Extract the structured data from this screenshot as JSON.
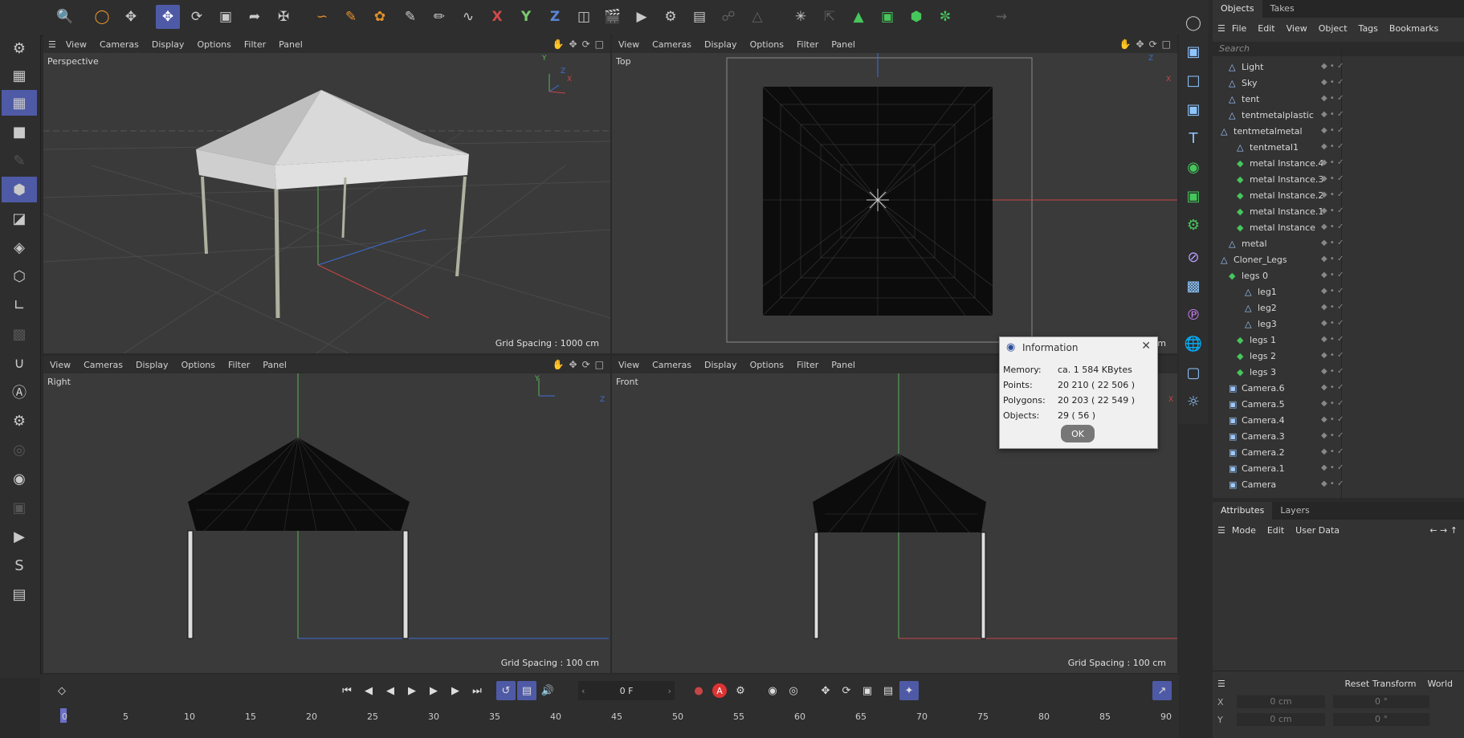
{
  "top_toolbar": {
    "icons": [
      "search-icon",
      "live-select-icon",
      "move-select-icon",
      "move-tool-icon",
      "rotate-tool-icon",
      "scale-tool-icon",
      "transform-icon",
      "pivot-icon",
      "spline-pen-icon",
      "brush-icon",
      "paint-icon",
      "knife-icon",
      "brush-tool-icon",
      "sketch-icon",
      "lasso-icon"
    ],
    "axis_x": "X",
    "axis_y": "Y",
    "axis_z": "Z"
  },
  "viewport_menu": [
    "View",
    "Cameras",
    "Display",
    "Options",
    "Filter",
    "Panel"
  ],
  "viewports": {
    "perspective": {
      "name": "Perspective",
      "grid": "Grid Spacing : 1000 cm"
    },
    "top": {
      "name": "Top",
      "grid_tail": "cm"
    },
    "right": {
      "name": "Right",
      "grid": "Grid Spacing : 100 cm"
    },
    "front": {
      "name": "Front",
      "grid": "Grid Spacing : 100 cm"
    }
  },
  "axis_labels": {
    "x": "X",
    "y": "Y",
    "z": "Z"
  },
  "info_dialog": {
    "title": "Information",
    "rows": [
      {
        "label": "Memory:",
        "value": "ca. 1 584 KBytes"
      },
      {
        "label": "Points:",
        "value": "20 210 ( 22 506 )"
      },
      {
        "label": "Polygons:",
        "value": "20 203 ( 22 549 )"
      },
      {
        "label": "Objects:",
        "value": "29 ( 56 )"
      }
    ],
    "ok": "OK"
  },
  "object_manager": {
    "tabs": [
      "Objects",
      "Takes"
    ],
    "menu": [
      "File",
      "Edit",
      "View",
      "Object",
      "Tags",
      "Bookmarks"
    ],
    "search_placeholder": "Search",
    "objects": [
      {
        "name": "Light",
        "indent": 1
      },
      {
        "name": "Sky",
        "indent": 1
      },
      {
        "name": "tent",
        "indent": 1
      },
      {
        "name": "tentmetalplastic",
        "indent": 1
      },
      {
        "name": "tentmetalmetal",
        "indent": 0
      },
      {
        "name": "tentmetal1",
        "indent": 2
      },
      {
        "name": "metal Instance.4",
        "indent": 2
      },
      {
        "name": "metal Instance.3",
        "indent": 2
      },
      {
        "name": "metal Instance.2",
        "indent": 2
      },
      {
        "name": "metal Instance.1",
        "indent": 2
      },
      {
        "name": "metal Instance",
        "indent": 2
      },
      {
        "name": "metal",
        "indent": 1
      },
      {
        "name": "Cloner_Legs",
        "indent": 0
      },
      {
        "name": "legs 0",
        "indent": 1
      },
      {
        "name": "leg1",
        "indent": 3
      },
      {
        "name": "leg2",
        "indent": 3
      },
      {
        "name": "leg3",
        "indent": 3
      },
      {
        "name": "legs 1",
        "indent": 2
      },
      {
        "name": "legs 2",
        "indent": 2
      },
      {
        "name": "legs 3",
        "indent": 2
      },
      {
        "name": "Camera.6",
        "indent": 1
      },
      {
        "name": "Camera.5",
        "indent": 1
      },
      {
        "name": "Camera.4",
        "indent": 1
      },
      {
        "name": "Camera.3",
        "indent": 1
      },
      {
        "name": "Camera.2",
        "indent": 1
      },
      {
        "name": "Camera.1",
        "indent": 1
      },
      {
        "name": "Camera",
        "indent": 1
      }
    ]
  },
  "attributes": {
    "tabs": [
      "Attributes",
      "Layers"
    ],
    "menu": [
      "Mode",
      "Edit",
      "User Data"
    ]
  },
  "coordinates": {
    "reset": "Reset Transform",
    "space": "World",
    "rows": [
      {
        "axis": "X",
        "pos": "0 cm",
        "rot": "0 °"
      },
      {
        "axis": "Y",
        "pos": "0 cm",
        "rot": "0 °"
      }
    ]
  },
  "timeline": {
    "frame": "0 F",
    "ticks": [
      "0",
      "5",
      "10",
      "15",
      "20",
      "25",
      "30",
      "35",
      "40",
      "45",
      "50",
      "55",
      "60",
      "65",
      "70",
      "75",
      "80",
      "85",
      "90"
    ]
  }
}
